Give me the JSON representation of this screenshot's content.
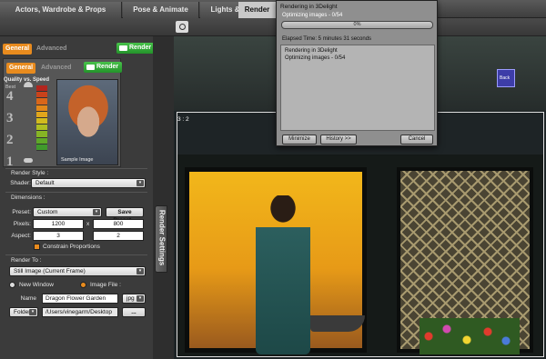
{
  "top_tabs": [
    {
      "label": "Actors, Wardrobe & Props",
      "active": false
    },
    {
      "label": "Pose & Animate",
      "active": false
    },
    {
      "label": "Lights & Cameras",
      "active": false
    },
    {
      "label": "Render",
      "active": true
    }
  ],
  "left": {
    "outer_tabs": {
      "general": "General",
      "advanced": "Advanced",
      "render": "Render"
    },
    "inner_tabs": {
      "general": "General",
      "advanced": "Advanced",
      "render": "Render"
    },
    "quality": {
      "title": "Quality vs. Speed",
      "best": "Best",
      "levels": [
        "4",
        "3",
        "2",
        "1"
      ],
      "sample_label": "Sample Image"
    },
    "render_style": {
      "label": "Render Style :",
      "shader_label": "Shader:",
      "shader_value": "Default"
    },
    "dimensions": {
      "label": "Dimensions :",
      "preset_label": "Preset:",
      "preset_value": "Custom",
      "save_preset": "Save Preset...",
      "pixels_label": "Pixels:",
      "width": "1200",
      "x": "x",
      "height": "800",
      "aspect_label": "Aspect:",
      "aspect_w": "3",
      "aspect_h": "2",
      "constrain": "Constrain Proportions"
    },
    "render_to": {
      "label": "Render To :",
      "target": "Still Image (Current Frame)",
      "new_window": "New Window",
      "image_file": "Image File :",
      "name_label": "Name",
      "name_value": "Dragon Flower Garden",
      "format": "jpg",
      "folder_label": "Folder",
      "path": "/Users/vinegarm/Desktop",
      "browse": "..."
    },
    "side_tab": "Render Settings"
  },
  "viewport": {
    "aspect_ratio": "3 : 2",
    "cube_label": "Back"
  },
  "dialog": {
    "title": "Rendering in 3Delight",
    "status": "Optimizing images - 0/54",
    "progress_label": "0%",
    "progress_percent": 0,
    "elapsed": "Elapsed Time:  5 minutes 31 seconds",
    "log": [
      "Rendering in 3Delight",
      "Optimizing images - 0/54"
    ],
    "buttons": {
      "minimize": "Minimize",
      "history": "History >>",
      "cancel": "Cancel"
    }
  },
  "colors": {
    "accent_orange": "#e88b1e",
    "render_green": "#2ea334",
    "progress_blue": "#5aa0e6"
  },
  "icons": [
    "camera-icon",
    "turtle-icon",
    "hare-icon",
    "dropdown-arrow-icon"
  ]
}
